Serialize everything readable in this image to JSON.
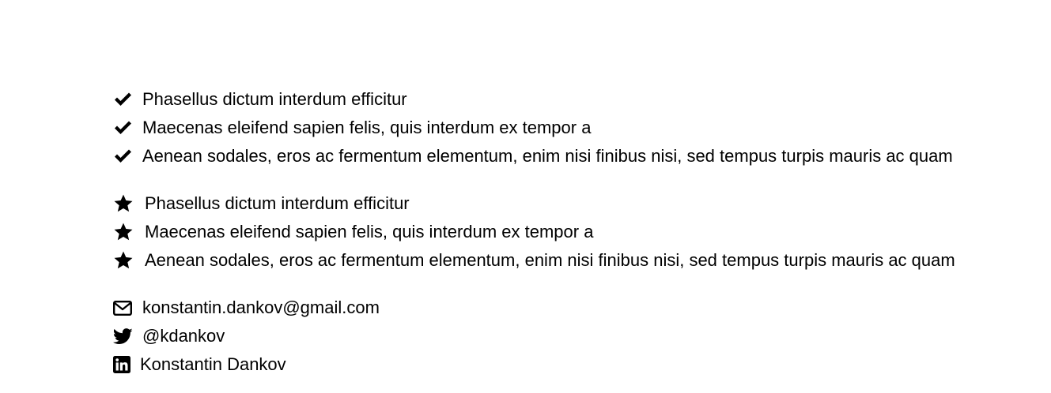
{
  "checklist": {
    "items": [
      {
        "icon": "check-icon",
        "text": "Phasellus dictum interdum efficitur"
      },
      {
        "icon": "check-icon",
        "text": "Maecenas eleifend sapien felis, quis interdum ex tempor a"
      },
      {
        "icon": "check-icon",
        "text": "Aenean sodales, eros ac fermentum elementum, enim nisi finibus nisi, sed tempus turpis mauris ac quam"
      }
    ]
  },
  "starlist": {
    "items": [
      {
        "icon": "star-icon",
        "text": "Phasellus dictum interdum efficitur"
      },
      {
        "icon": "star-icon",
        "text": "Maecenas eleifend sapien felis, quis interdum ex tempor a"
      },
      {
        "icon": "star-icon",
        "text": "Aenean sodales, eros ac fermentum elementum, enim nisi finibus nisi, sed tempus turpis mauris ac quam"
      }
    ]
  },
  "contacts": {
    "email": {
      "icon": "envelope-icon",
      "text": "konstantin.dankov@gmail.com"
    },
    "twitter": {
      "icon": "twitter-icon",
      "text": "@kdankov"
    },
    "linkedin": {
      "icon": "linkedin-icon",
      "text": "Konstantin Dankov"
    }
  },
  "colors": {
    "text": "#000000",
    "background": "#ffffff"
  }
}
